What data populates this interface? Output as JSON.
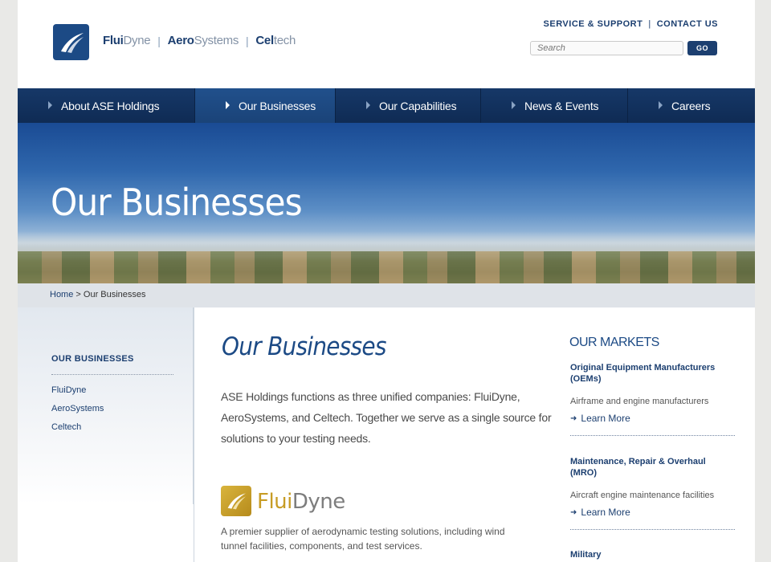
{
  "header": {
    "brands": [
      {
        "bold": "Flui",
        "light": "Dyne"
      },
      {
        "bold": "Aero",
        "light": "Systems"
      },
      {
        "bold": "Cel",
        "light": "tech"
      }
    ],
    "brand_separator": "|",
    "util_links": [
      "SERVICE & SUPPORT",
      "CONTACT US"
    ],
    "util_separator": "|",
    "search_placeholder": "Search",
    "go_label": "GO"
  },
  "nav": {
    "items": [
      {
        "label": "About ASE Holdings",
        "active": false
      },
      {
        "label": "Our Businesses",
        "active": true
      },
      {
        "label": "Our Capabilities",
        "active": false
      },
      {
        "label": "News & Events",
        "active": false
      },
      {
        "label": "Careers",
        "active": false
      }
    ]
  },
  "hero": {
    "title": "Our Businesses"
  },
  "breadcrumb": {
    "home": "Home",
    "separator": " > ",
    "current": "Our Businesses"
  },
  "sidebar": {
    "title": "OUR BUSINESSES",
    "links": [
      "FluiDyne",
      "AeroSystems",
      "Celtech"
    ]
  },
  "main": {
    "title": "Our Businesses",
    "intro": "ASE Holdings functions as three unified companies: FluiDyne, AeroSystems, and Celtech. Together we serve as a single source for solutions to your testing needs.",
    "fluidyne": {
      "name_a": "Flui",
      "name_b": "Dyne",
      "description": "A premier supplier of aerodynamic testing solutions, including wind tunnel facilities, components, and test services."
    }
  },
  "markets": {
    "title": "OUR MARKETS",
    "items": [
      {
        "heading": "Original Equipment Manufacturers (OEMs)",
        "desc": "Airframe and engine manufacturers",
        "more": "Learn More"
      },
      {
        "heading": "Maintenance, Repair & Overhaul (MRO)",
        "desc": "Aircraft engine maintenance facilities",
        "more": "Learn More"
      },
      {
        "heading": "Military"
      }
    ]
  },
  "colors": {
    "brand_navy": "#1c3f70",
    "nav_bg": "#163868",
    "fluidyne_gold": "#c79c25"
  }
}
